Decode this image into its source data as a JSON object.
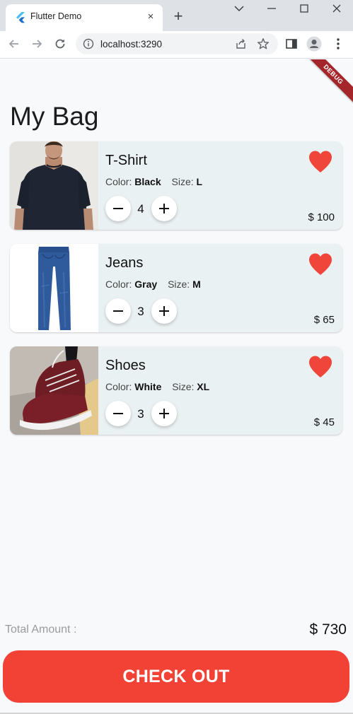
{
  "browser": {
    "tab_title": "Flutter Demo",
    "url": "localhost:3290",
    "close_label": "×",
    "new_tab_label": "+"
  },
  "app": {
    "debug_banner": "DEBUG",
    "page_title": "My Bag",
    "items": [
      {
        "name": "T-Shirt",
        "color_label": "Color:",
        "color": "Black",
        "size_label": "Size:",
        "size": "L",
        "quantity": "4",
        "price": "$ 100",
        "favorite": true,
        "image": "t-shirt-image"
      },
      {
        "name": "Jeans",
        "color_label": "Color:",
        "color": "Gray",
        "size_label": "Size:",
        "size": "M",
        "quantity": "3",
        "price": "$ 65",
        "favorite": true,
        "image": "jeans-image"
      },
      {
        "name": "Shoes",
        "color_label": "Color:",
        "color": "White",
        "size_label": "Size:",
        "size": "XL",
        "quantity": "3",
        "price": "$ 45",
        "favorite": true,
        "image": "shoes-image"
      }
    ],
    "total_label": "Total Amount :",
    "total_value": "$ 730",
    "checkout_label": "CHECK OUT"
  },
  "colors": {
    "accent": "#f24236",
    "card_bg": "#eaf1f2",
    "heart": "#f0453b",
    "page_bg": "#f8f9fb"
  }
}
